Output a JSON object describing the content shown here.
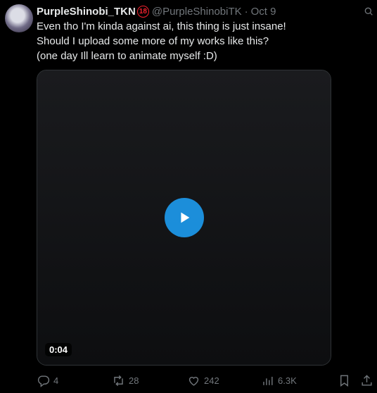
{
  "tweet": {
    "display_name": "PurpleShinobi_TKN",
    "badge_text": "18",
    "handle": "@PurpleShinobiTK",
    "separator": "·",
    "date": "Oct 9",
    "text_lines": [
      "Even tho I'm kinda against ai, this thing is just insane!",
      "Should I upload some more of my works like this?",
      "(one day Ill learn to animate myself :D)"
    ],
    "media": {
      "type": "video",
      "duration": "0:04"
    },
    "stats": {
      "replies": "4",
      "retweets": "28",
      "likes": "242",
      "views": "6.3K"
    }
  },
  "icons": [
    "more-icon",
    "reply-icon",
    "retweet-icon",
    "like-icon",
    "views-icon",
    "bookmark-icon",
    "share-icon",
    "play-icon"
  ],
  "colors": {
    "background": "#000000",
    "text": "#e7e9ea",
    "muted": "#71767b",
    "badge": "#f4212e"
  }
}
